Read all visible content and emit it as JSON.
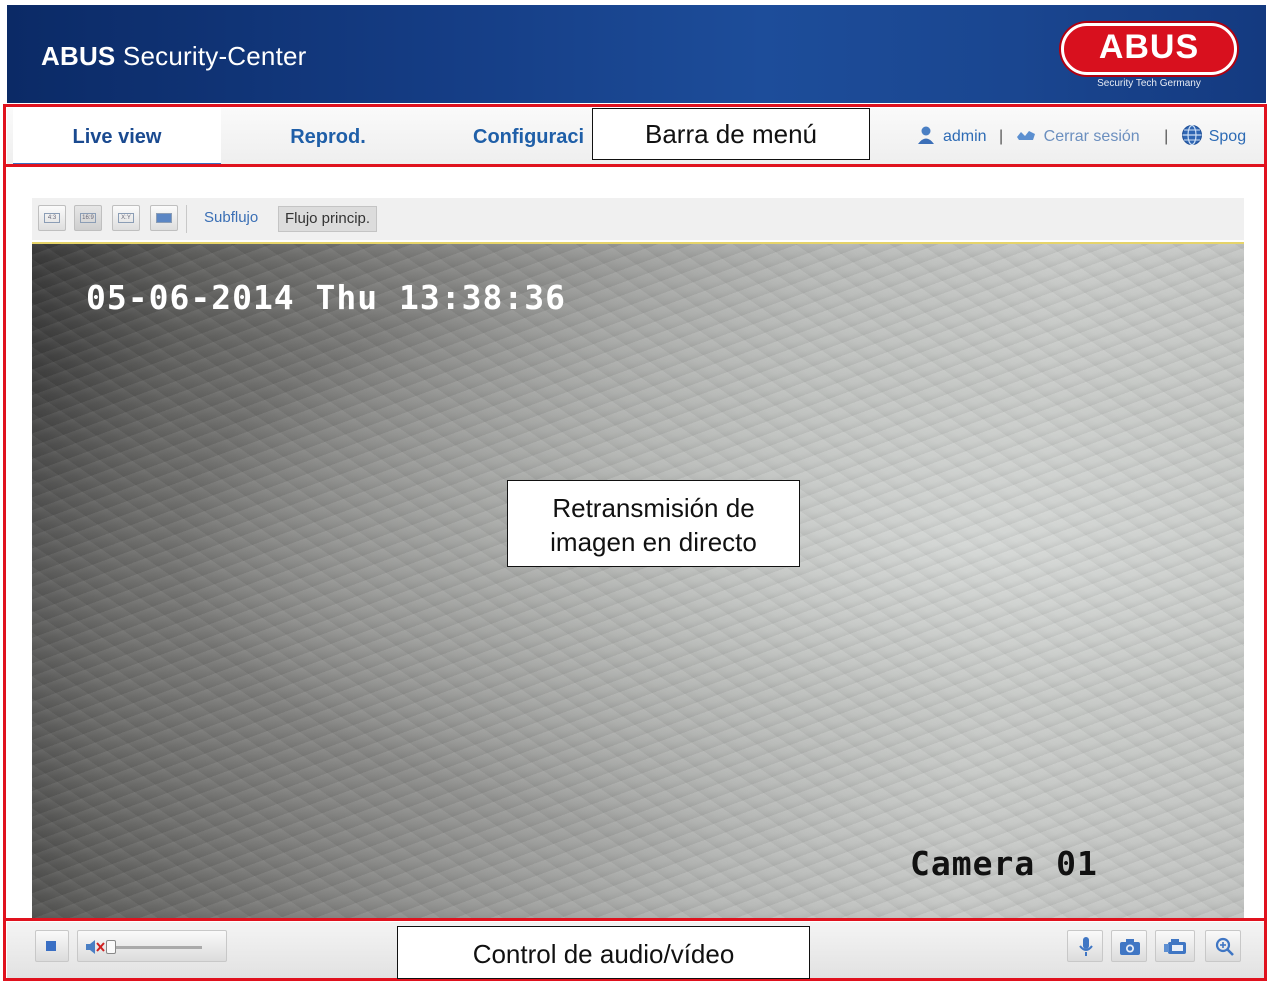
{
  "header": {
    "app_title_brand": "ABUS",
    "app_title_rest": "Security-Center",
    "logo_text": "ABUS",
    "logo_tagline": "Security Tech Germany"
  },
  "menu": {
    "tabs": [
      {
        "label": "Live view",
        "active": true
      },
      {
        "label": "Reprod.",
        "active": false
      },
      {
        "label": "Configuraci",
        "active": false
      }
    ],
    "user": "admin",
    "logout": "Cerrar sesión",
    "language": "Spog",
    "separator": "|"
  },
  "toolbar": {
    "aspect_buttons": [
      "4:3",
      "16:9",
      "X:Y",
      "fit"
    ],
    "substream": "Subflujo",
    "mainstream": "Flujo princip."
  },
  "video": {
    "osd_datetime": "05-06-2014 Thu 13:38:36",
    "osd_camera": "Camera 01"
  },
  "annotations": {
    "menu_bar": "Barra de menú",
    "live_stream_line1": "Retransmisión de",
    "live_stream_line2": "imagen en directo",
    "av_control": "Control de audio/vídeo"
  },
  "colors": {
    "header_bg": "#153d85",
    "link_blue": "#1f5fa8",
    "annotation_red": "#e0121e",
    "logo_red": "#d8101e"
  }
}
